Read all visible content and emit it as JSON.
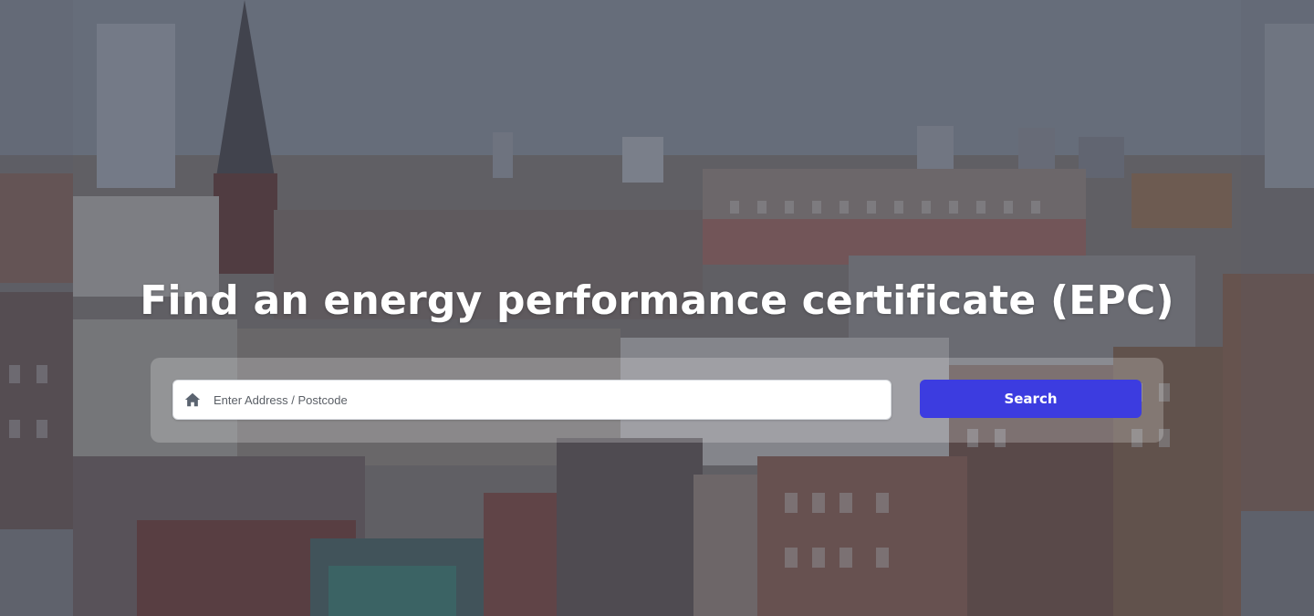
{
  "hero": {
    "title": "Find an energy performance certificate (EPC)",
    "background_image": "city-rooftops-photo"
  },
  "search": {
    "placeholder": "Enter Address / Postcode",
    "value": "",
    "icon": "home-icon",
    "button_label": "Search"
  },
  "colors": {
    "button": "#3c3ce0",
    "title_text": "#ffffff",
    "overlay": "#373e4e"
  }
}
